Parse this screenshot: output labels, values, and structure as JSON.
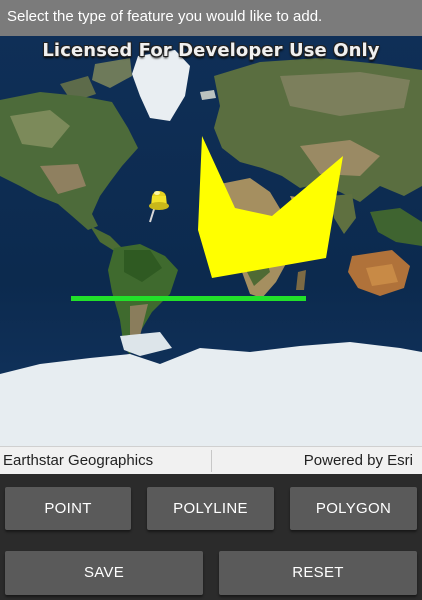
{
  "prompt": {
    "text": "Select the type of feature you would like to add."
  },
  "map": {
    "watermark": "Licensed For Developer Use Only",
    "features": {
      "point_color": "#f2e22b",
      "polyline_color": "#22e12a",
      "polygon_color": "#ffff00"
    }
  },
  "attribution": {
    "source": "Earthstar Geographics",
    "powered_by": "Powered by Esri"
  },
  "buttons": {
    "point": "POINT",
    "polyline": "POLYLINE",
    "polygon": "POLYGON",
    "save": "SAVE",
    "reset": "RESET"
  }
}
